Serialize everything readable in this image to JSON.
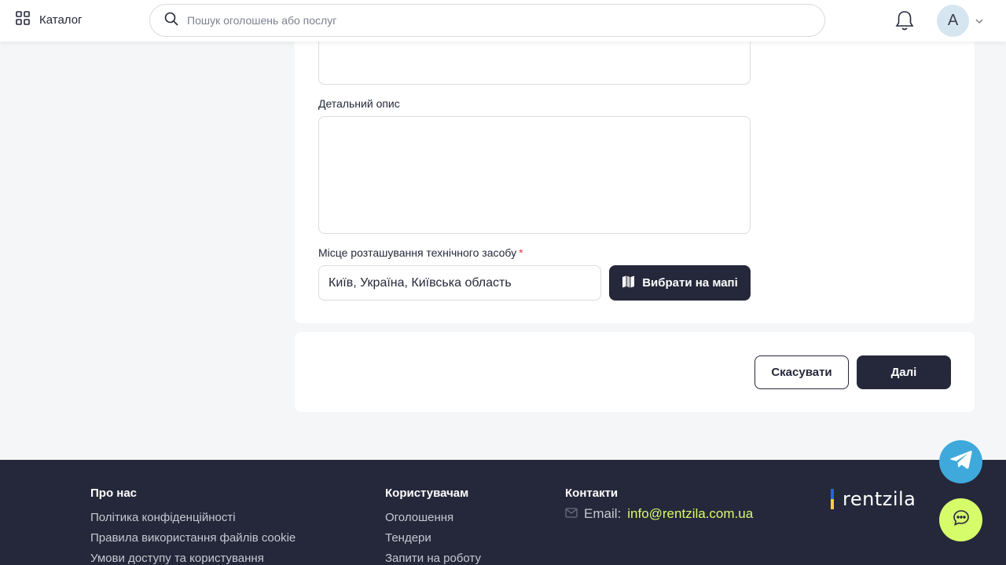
{
  "header": {
    "catalog_label": "Каталог",
    "search_placeholder": "Пошук оголошень або послуг",
    "avatar_letter": "A"
  },
  "form": {
    "detail_label": "Детальний опис",
    "location_label": "Місце розташування технічного засобу",
    "required_mark": "*",
    "location_value": "Київ, Україна, Київська область",
    "map_button": "Вибрати на мапі"
  },
  "actions": {
    "cancel": "Скасувати",
    "next": "Далі"
  },
  "footer": {
    "about": {
      "title": "Про нас",
      "links": [
        "Політика конфіденційності",
        "Правила використання файлів cookie",
        "Умови доступу та користування"
      ]
    },
    "users": {
      "title": "Користувачам",
      "links": [
        "Оголошення",
        "Тендери",
        "Запити на роботу"
      ]
    },
    "contacts": {
      "title": "Контакти",
      "email_label": "Email:",
      "email": "info@rentzila.com.ua"
    },
    "logo_text": "rentzila"
  },
  "colors": {
    "dark": "#25283a",
    "accent_green": "#d7fc6a",
    "telegram_blue": "#3fa9dc",
    "required_red": "#e8353b"
  }
}
